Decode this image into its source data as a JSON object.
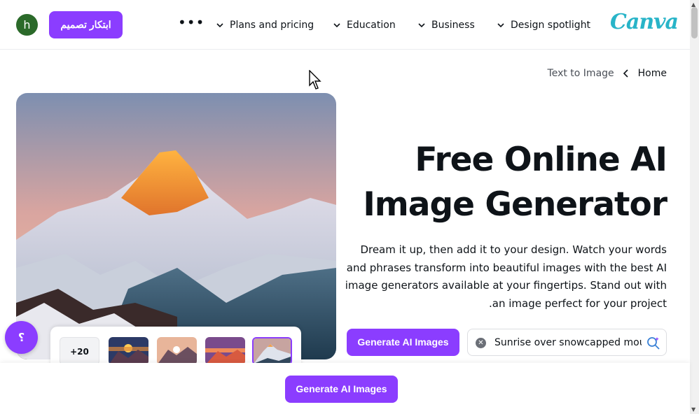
{
  "header": {
    "avatar_letter": "h",
    "create_design_label": "ابتكار تصميم",
    "nav": [
      {
        "label": "Plans and pricing"
      },
      {
        "label": "Education"
      },
      {
        "label": "Business"
      },
      {
        "label": "Design spotlight"
      }
    ],
    "logo_text": "Canva"
  },
  "breadcrumb": {
    "home": "Home",
    "current": "Text to Image"
  },
  "hero": {
    "title_line1": "Free Online AI",
    "title_line2": "Image Generator",
    "description": "Dream it up, then add it to your design. Watch your words and phrases transform into beautiful images with the best AI image generators available at your fingertips. Stand out with an image perfect for your project.",
    "generate_button": "Generate AI Images",
    "prompt_value": "Sunrise over snowcapped mountains"
  },
  "thumbnails": {
    "more_label": "+20",
    "selected_index": 3
  },
  "help_label": "؟",
  "bottom_bar": {
    "generate_button": "Generate AI Images"
  },
  "colors": {
    "accent": "#8b3dff",
    "logo": "#28b4c8"
  }
}
